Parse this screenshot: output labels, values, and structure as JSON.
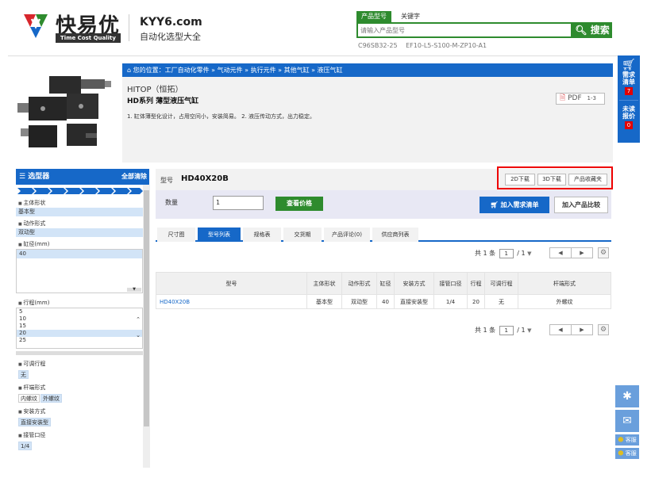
{
  "header": {
    "logo_cn": "快易优",
    "logo_en": "Time Cost Quality",
    "site_name": "KYY6.com",
    "site_tagline": "自动化选型大全",
    "search_tabs": [
      "产品型号",
      "关键字"
    ],
    "search_placeholder": "请输入产品型号",
    "search_button": "搜索",
    "search_hints": [
      "C96SB32-25",
      "EF10-L5-S100-M-ZP10-A1"
    ]
  },
  "breadcrumb": "您的位置：工厂自动化零件 » 气动元件 » 执行元件 » 其他气缸 » 液压气缸",
  "product": {
    "brand": "HITOP（恒拓）",
    "series": "HD系列 薄型液压气缸",
    "feature": "1. 缸体薄型化设计，占用空间小，安装简易。 2. 液压传动方式，出力稳定。",
    "pdf_label": "PDF",
    "pdf_pages": "1-3"
  },
  "right_float": {
    "cart_label": "需求清单",
    "cart_count": "7",
    "quote_label": "未读报价",
    "quote_count": "0",
    "kefu": "客服"
  },
  "sidebar": {
    "title": "选型器",
    "clear": "全部清除",
    "groups": [
      {
        "label": "主体形状",
        "selected": "基本型"
      },
      {
        "label": "动作形式",
        "selected": "双动型"
      },
      {
        "label": "缸径(mm)",
        "options": [
          "40"
        ],
        "selected": "40"
      },
      {
        "label": "行程(mm)",
        "options": [
          "5",
          "10",
          "15",
          "20",
          "25"
        ],
        "selected": "20"
      },
      {
        "label": "可调行程",
        "chips": [
          "无"
        ],
        "selected": "无"
      },
      {
        "label": "杆端形式",
        "chips": [
          "内螺纹",
          "外螺纹"
        ],
        "selected": "外螺纹"
      },
      {
        "label": "安装方式",
        "chips": [
          "直接安装型"
        ],
        "selected": "直接安装型"
      },
      {
        "label": "接管口径",
        "chips": [
          "1/4"
        ],
        "selected": "1/4"
      }
    ]
  },
  "model": {
    "label": "型号",
    "value": "HD40X20B",
    "btn_2d": "2D下载",
    "btn_3d": "3D下载",
    "btn_fav": "产品收藏夹"
  },
  "order": {
    "qty_label": "数量",
    "qty_value": "1",
    "price_btn": "查看价格",
    "add_list_btn": "加入需求清单",
    "compare_btn": "加入产品比较"
  },
  "tabs": [
    "尺寸图",
    "型号列表",
    "规格表",
    "交货期",
    "产品评论(0)",
    "供应商列表"
  ],
  "active_tab": 1,
  "pager": {
    "prefix": "共 1 条",
    "page": "1",
    "total": "/ 1"
  },
  "table": {
    "headers": [
      "型号",
      "主体形状",
      "动作形式",
      "缸径",
      "安装方式",
      "接管口径",
      "行程",
      "可调行程",
      "杆端形式"
    ],
    "rows": [
      [
        "HD40X20B",
        "基本型",
        "双动型",
        "40",
        "直接安装型",
        "1/4",
        "20",
        "无",
        "外螺纹"
      ]
    ]
  },
  "colors": {
    "brand_blue": "#1668c8",
    "brand_green": "#2e8b2e",
    "highlight_red": "#e00000"
  }
}
